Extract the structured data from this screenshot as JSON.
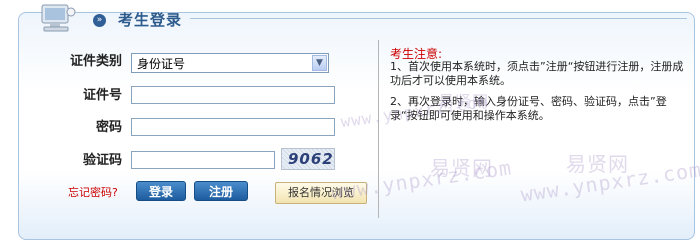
{
  "header": {
    "title": "考生登录",
    "bullet": "»"
  },
  "form": {
    "id_type_label": "证件类别",
    "id_type_value": "身份证号",
    "id_number_label": "证件号",
    "password_label": "密码",
    "captcha_label": "验证码",
    "captcha_image_text": "9062",
    "forgot_password": "忘记密码?",
    "login_button": "登录",
    "register_button": "注册",
    "browse_button": "报名情况浏览"
  },
  "notice": {
    "title": "考生注意:",
    "item1": "1、首次使用本系统时，须点击”注册“按钮进行注册，注册成功后才可以使用本系统。",
    "item2": "2、再次登录时，输入身份证号、密码、验证码，点击”登录“按钮即可使用和操作本系统。"
  },
  "watermark": {
    "cn": "易贤网",
    "url": "www.ynpxrz.com"
  },
  "colors": {
    "accent": "#2d5b8c",
    "notice_red": "#cc0000",
    "button_blue": "#1d5c9e"
  }
}
